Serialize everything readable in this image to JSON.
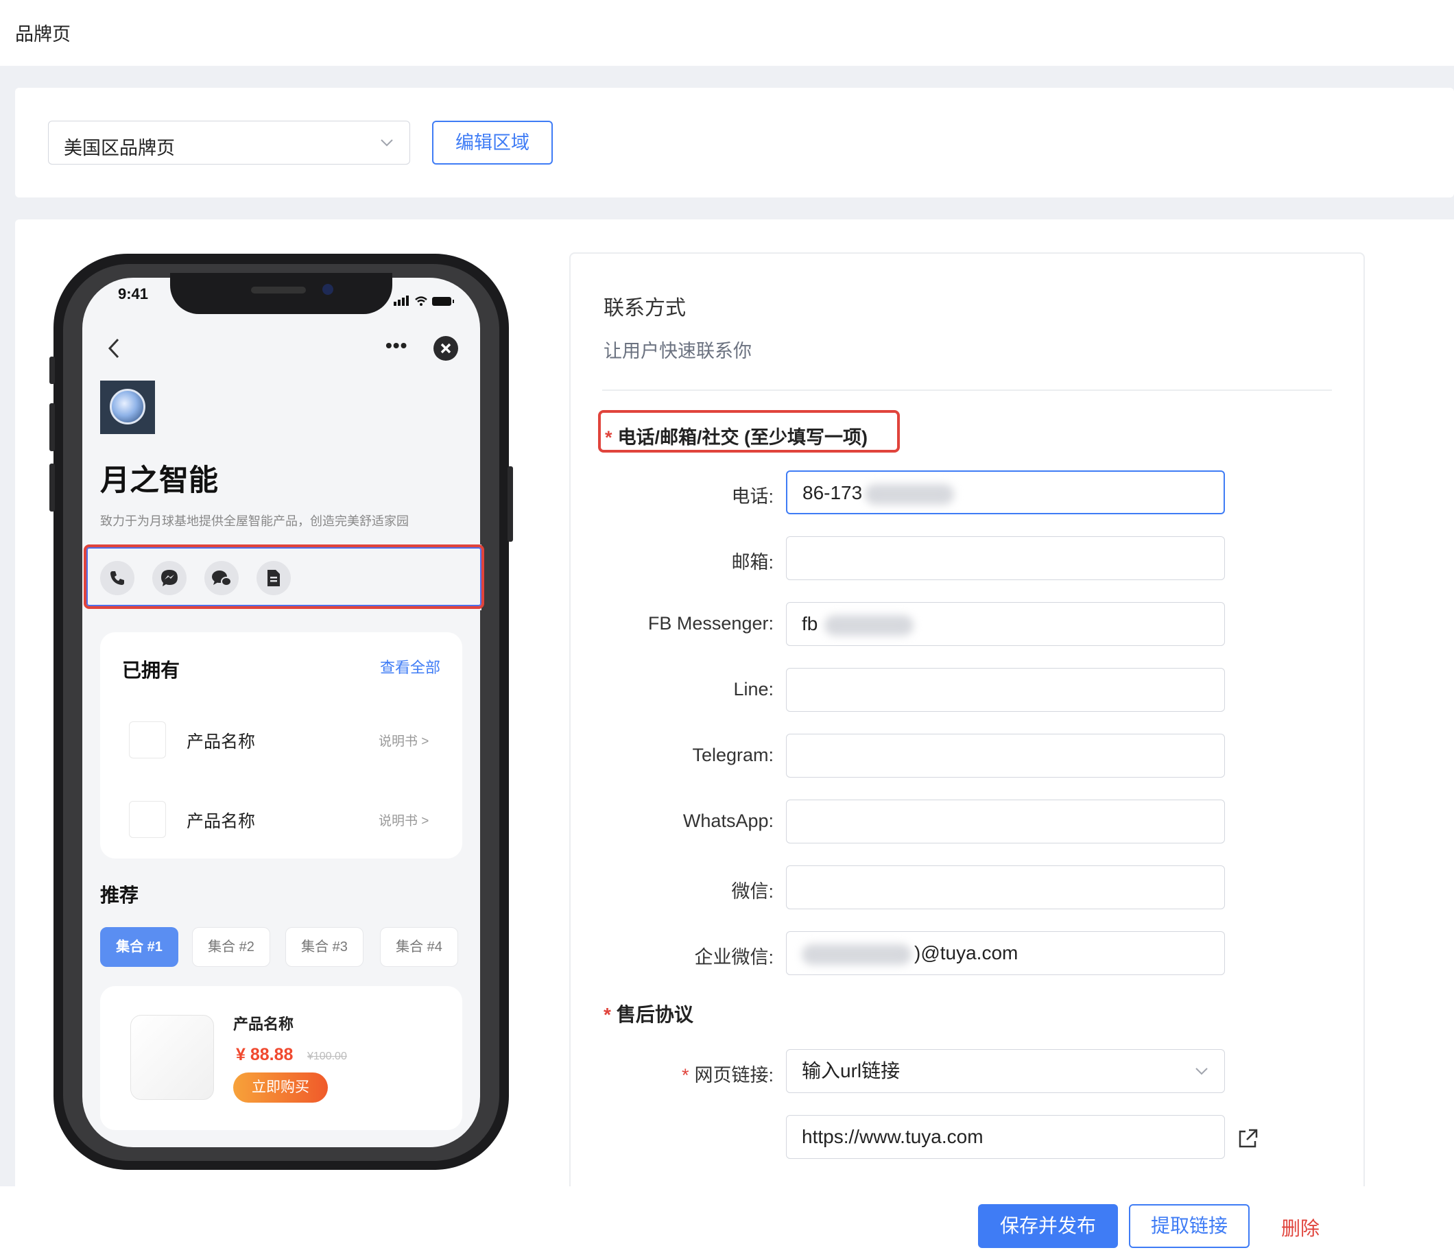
{
  "page": {
    "title": "品牌页"
  },
  "region": {
    "selected": "美国区品牌页",
    "edit_label": "编辑区域"
  },
  "phone": {
    "time": "9:41",
    "brand_name": "月之智能",
    "brand_desc": "致力于为月球基地提供全屋智能产品，创造完美舒适家园",
    "contact_icons": [
      "phone-icon",
      "messenger-icon",
      "chat-icon",
      "document-icon"
    ],
    "owned": {
      "title": "已拥有",
      "view_all": "查看全部",
      "items": [
        {
          "name": "产品名称",
          "manual": "说明书"
        },
        {
          "name": "产品名称",
          "manual": "说明书"
        }
      ]
    },
    "recommend": {
      "title": "推荐",
      "tabs": [
        "集合 #1",
        "集合 #2",
        "集合 #3",
        "集合 #4"
      ],
      "active_tab": 0,
      "product": {
        "name": "产品名称",
        "price": "¥ 88.88",
        "old_price": "¥100.00",
        "buy": "立即购买"
      }
    }
  },
  "form": {
    "section_title": "联系方式",
    "section_subtitle": "让用户快速联系你",
    "contact_group_label": "电话/邮箱/社交 (至少填写一项)",
    "fields": [
      {
        "label": "电话",
        "value": "86-173"
      },
      {
        "label": "邮箱",
        "value": ""
      },
      {
        "label": "FB Messenger",
        "value": "fb"
      },
      {
        "label": "Line",
        "value": ""
      },
      {
        "label": "Telegram",
        "value": ""
      },
      {
        "label": "WhatsApp",
        "value": ""
      },
      {
        "label": "微信",
        "value": ""
      },
      {
        "label": "企业微信",
        "value": ")@tuya.com"
      }
    ],
    "after_sale": {
      "title": "售后协议",
      "url_label": "网页链接",
      "url_type": "输入url链接",
      "url_value": "https://www.tuya.com"
    }
  },
  "actions": {
    "save_publish": "保存并发布",
    "get_link": "提取链接",
    "delete": "删除"
  },
  "colors": {
    "primary": "#3f7cf5",
    "danger": "#e0443c",
    "price": "#f0492f"
  }
}
